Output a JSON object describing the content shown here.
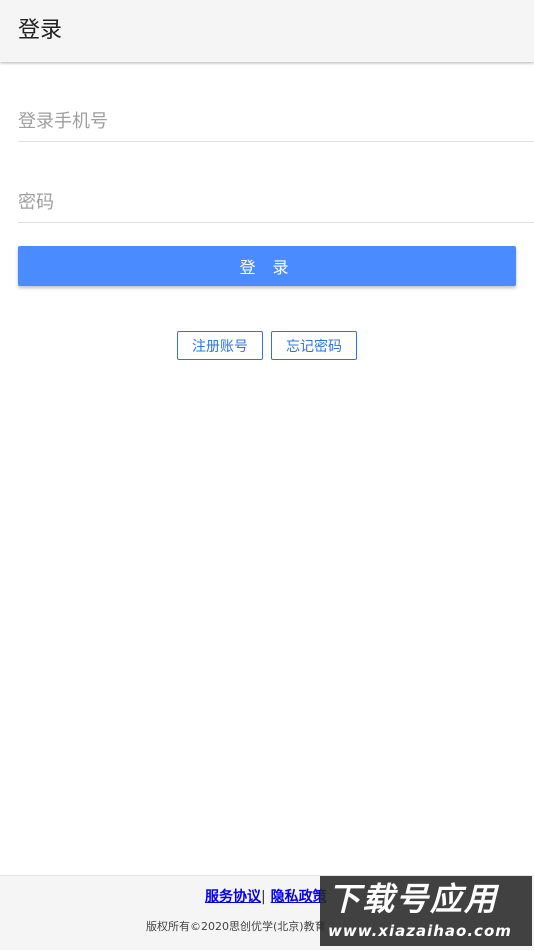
{
  "app_bar": {
    "title": "登录"
  },
  "form": {
    "phone_placeholder": "登录手机号",
    "password_placeholder": "密码",
    "login_label": "登 录"
  },
  "actions": {
    "register_label": "注册账号",
    "forgot_label": "忘记密码"
  },
  "footer": {
    "service_agreement": "服务协议",
    "separator": "|",
    "privacy_policy": "隐私政策",
    "copyright": "版权所有©2020思创优学(北京)教育"
  },
  "watermark": {
    "main": "下载号应用",
    "sub": "www.xiazaihao.com"
  },
  "colors": {
    "primary": "#4a8cff",
    "outline": "#2f74e6",
    "link": "#0000ee"
  }
}
